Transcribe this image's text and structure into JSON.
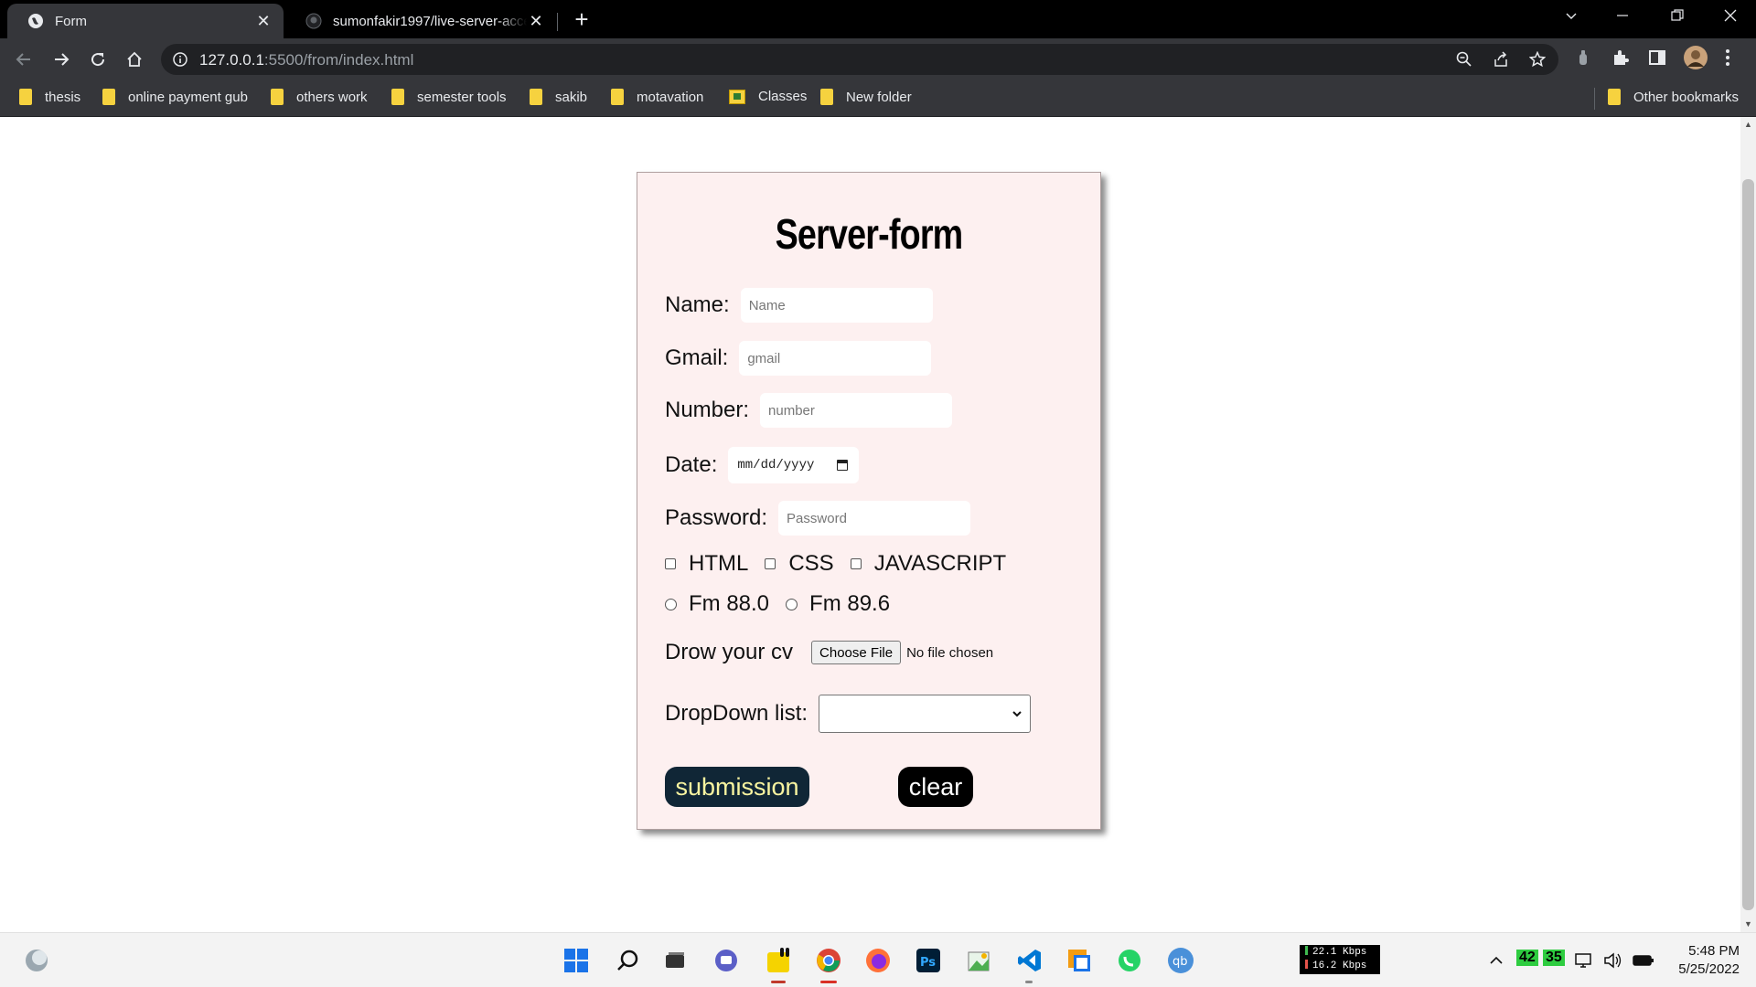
{
  "browser": {
    "tabs": [
      {
        "title": "Form",
        "active": true
      },
      {
        "title": "sumonfakir1997/live-server-acce",
        "active": false
      }
    ],
    "url_host": "127.0.0.1",
    "url_rest": ":5500/from/index.html",
    "bookmarks": [
      "thesis",
      "online payment gub",
      "others work",
      "semester tools",
      "sakib",
      "motavation",
      "Classes",
      "New folder"
    ],
    "other_bookmarks": "Other bookmarks"
  },
  "form": {
    "title": "Server-form",
    "name_label": "Name:",
    "name_placeholder": "Name",
    "gmail_label": "Gmail:",
    "gmail_placeholder": "gmail",
    "number_label": "Number:",
    "number_placeholder": "number",
    "date_label": "Date:",
    "date_value": "mm/dd/yyyy",
    "password_label": "Password:",
    "password_placeholder": "Password",
    "checkboxes": [
      "HTML",
      "CSS",
      "JAVASCRIPT"
    ],
    "radios": [
      "Fm 88.0",
      "Fm 89.6"
    ],
    "cv_label": "Drow your cv",
    "file_button": "Choose File",
    "file_status": "No file chosen",
    "dropdown_label": "DropDown list:",
    "dropdown_value": "",
    "submit_label": "submission",
    "clear_label": "clear"
  },
  "taskbar": {
    "net_up": "22.1 Kbps",
    "net_down": "16.2 Kbps",
    "tray_a": "42",
    "tray_b": "35",
    "time": "5:48 PM",
    "date": "5/25/2022"
  },
  "colors": {
    "card_bg": "#fdf0f0",
    "submit_bg": "#102636",
    "submit_text": "#f8f4a0",
    "clear_bg": "#000000",
    "folder_yellow": "#f6d23f"
  }
}
